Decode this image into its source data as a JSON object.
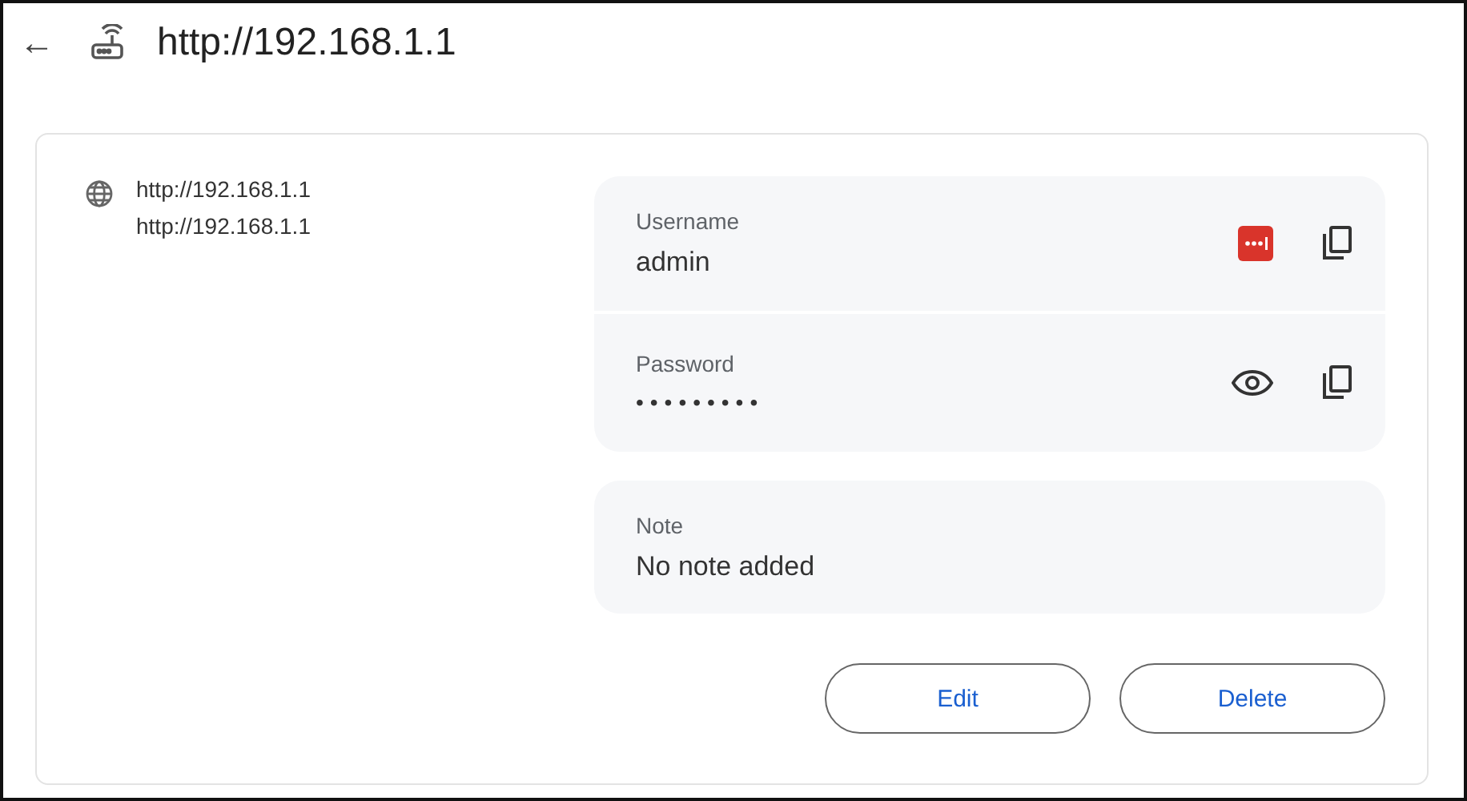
{
  "header": {
    "back": "←",
    "title": "http://192.168.1.1"
  },
  "sites": [
    "http://192.168.1.1",
    "http://192.168.1.1"
  ],
  "credentials": [
    {
      "kind": "username",
      "label": "Username",
      "value": "admin"
    },
    {
      "kind": "password",
      "label": "Password",
      "value": "•••••••••"
    }
  ],
  "note": {
    "label": "Note",
    "value": "No note added"
  },
  "buttons": [
    "Edit",
    "Delete"
  ]
}
